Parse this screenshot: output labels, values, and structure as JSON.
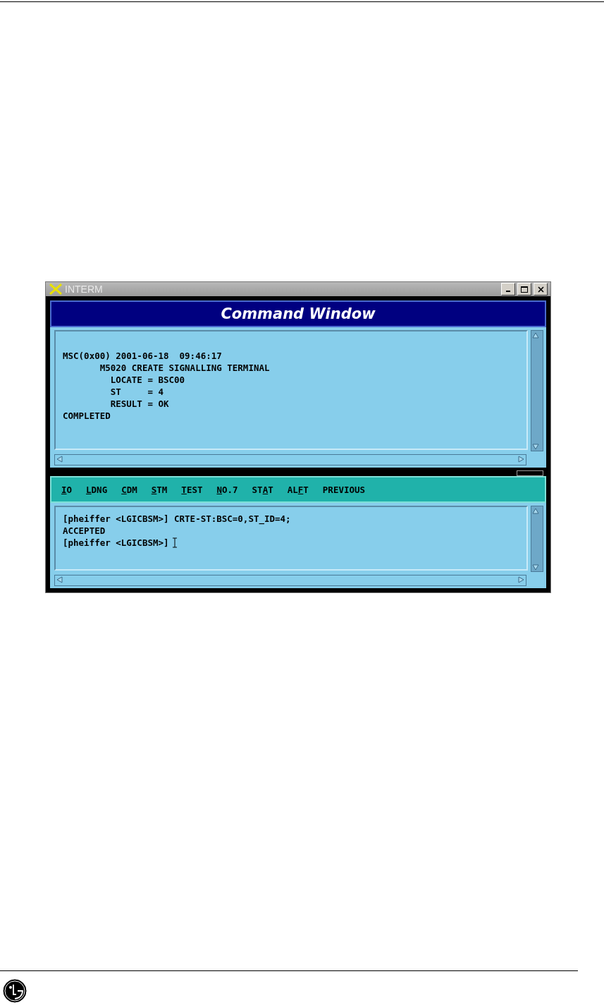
{
  "window": {
    "title": "INTERM",
    "header": "Command Window"
  },
  "output": {
    "lines": [
      "MSC(0x00) 2001-06-18  09:46:17",
      "       M5020 CREATE SIGNALLING TERMINAL",
      "         LOCATE = BSC00",
      "         ST     = 4",
      "         RESULT = OK",
      "COMPLETED"
    ]
  },
  "menu": [
    {
      "key": "I",
      "after": "O"
    },
    {
      "key": "L",
      "after": "DNG"
    },
    {
      "key": "C",
      "after": "DM"
    },
    {
      "key": "S",
      "after": "TM"
    },
    {
      "key": "T",
      "after": "EST"
    },
    {
      "key": "N",
      "after": "O.7"
    },
    {
      "before": "ST",
      "key": "A",
      "after": "T"
    },
    {
      "before": "AL",
      "key": "F",
      "after": "T"
    },
    {
      "before": "PREVIOUS"
    }
  ],
  "input": {
    "lines": [
      "[pheiffer <LGICBSM>] CRTE-ST:BSC=0,ST_ID=4;",
      "ACCEPTED",
      "[pheiffer <LGICBSM>]"
    ]
  }
}
